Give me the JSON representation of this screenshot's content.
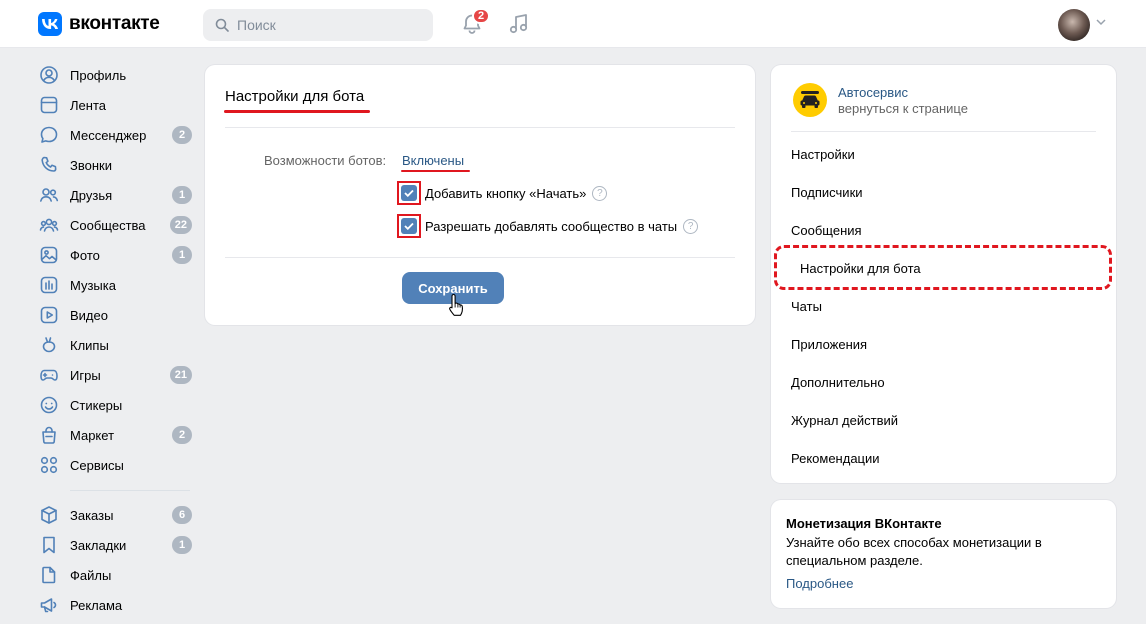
{
  "header": {
    "logo_text": "вконтакте",
    "search_placeholder": "Поиск",
    "notifications_count": "2"
  },
  "sidebar": {
    "items": [
      {
        "label": "Профиль",
        "icon": "profile-icon",
        "count": ""
      },
      {
        "label": "Лента",
        "icon": "news-icon",
        "count": ""
      },
      {
        "label": "Мессенджер",
        "icon": "messenger-icon",
        "count": "2"
      },
      {
        "label": "Звонки",
        "icon": "phone-icon",
        "count": ""
      },
      {
        "label": "Друзья",
        "icon": "friends-icon",
        "count": "1"
      },
      {
        "label": "Сообщества",
        "icon": "communities-icon",
        "count": "22"
      },
      {
        "label": "Фото",
        "icon": "photo-icon",
        "count": "1"
      },
      {
        "label": "Музыка",
        "icon": "music-icon",
        "count": ""
      },
      {
        "label": "Видео",
        "icon": "video-icon",
        "count": ""
      },
      {
        "label": "Клипы",
        "icon": "clips-icon",
        "count": ""
      },
      {
        "label": "Игры",
        "icon": "games-icon",
        "count": "21"
      },
      {
        "label": "Стикеры",
        "icon": "stickers-icon",
        "count": ""
      },
      {
        "label": "Маркет",
        "icon": "market-icon",
        "count": "2"
      },
      {
        "label": "Сервисы",
        "icon": "services-icon",
        "count": ""
      }
    ],
    "items2": [
      {
        "label": "Заказы",
        "icon": "orders-icon",
        "count": "6"
      },
      {
        "label": "Закладки",
        "icon": "bookmarks-icon",
        "count": "1"
      },
      {
        "label": "Файлы",
        "icon": "files-icon",
        "count": ""
      },
      {
        "label": "Реклама",
        "icon": "ads-icon",
        "count": ""
      }
    ]
  },
  "main": {
    "title": "Настройки для бота",
    "bots_label": "Возможности ботов:",
    "bots_value": "Включены",
    "checkbox_start": "Добавить кнопку «Начать»",
    "checkbox_chats": "Разрешать добавлять сообщество в чаты",
    "save_label": "Сохранить"
  },
  "menu": {
    "community_name": "Автосервис",
    "community_back": "вернуться к странице",
    "items": [
      "Настройки",
      "Подписчики",
      "Сообщения",
      "Настройки для бота",
      "Чаты",
      "Приложения",
      "Дополнительно",
      "Журнал действий",
      "Рекомендации"
    ],
    "active_index": 3
  },
  "monetization": {
    "title": "Монетизация ВКонтакте",
    "text": "Узнайте обо всех способах монетизации в специальном разделе.",
    "link": "Подробнее"
  },
  "colors": {
    "accent": "#5181b8",
    "link": "#2a5885",
    "vk_blue": "#0077ff",
    "highlight_red": "#e0171f",
    "badge_grey": "#aeb7c2"
  }
}
